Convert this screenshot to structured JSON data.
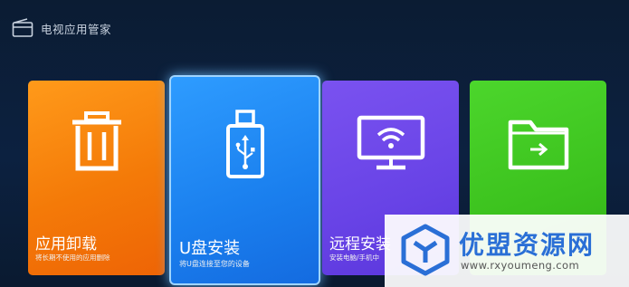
{
  "header": {
    "title": "电视应用管家",
    "icon": "tv-box-icon"
  },
  "tiles": [
    {
      "title": "应用卸载",
      "subtitle": "将长期不使用的应用删除",
      "icon": "trash-icon",
      "color": "#f47a08"
    },
    {
      "title": "U盘安装",
      "subtitle": "将U盘连接至您的设备",
      "icon": "usb-drive-icon",
      "color": "#1a7fee",
      "selected": true
    },
    {
      "title": "远程安装",
      "subtitle": "安装电脑/手机中",
      "icon": "wifi-monitor-icon",
      "color": "#6843e6"
    },
    {
      "title": "",
      "subtitle": "",
      "icon": "folder-arrow-icon",
      "color": "#3cc21e"
    }
  ],
  "watermark": {
    "name": "优盟资源网",
    "url": "www.rxyoumeng.com",
    "icon": "cube-logo-icon",
    "color": "#2a6fd6"
  }
}
